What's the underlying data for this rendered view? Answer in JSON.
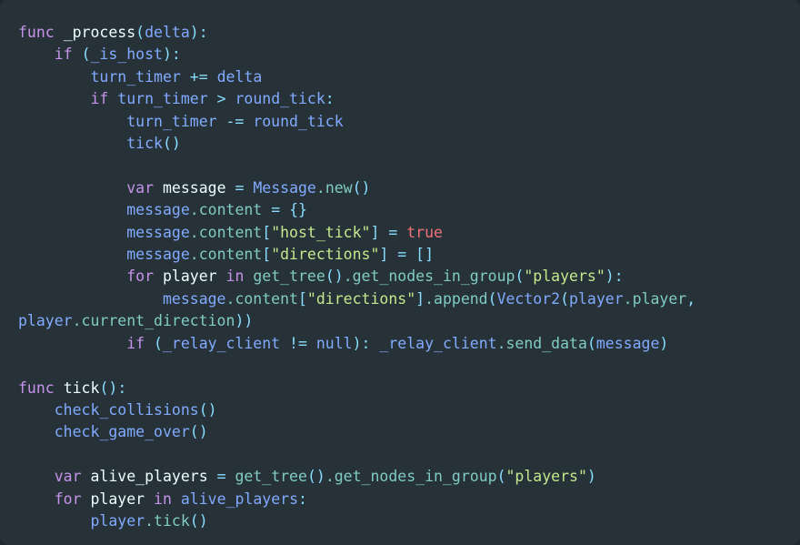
{
  "editor": {
    "background": "#263238",
    "outer_background": "#22292e",
    "language": "gdscript",
    "colors": {
      "keyword": "#c792ea",
      "identifier": "#82aaff",
      "member": "#80cbc4",
      "string": "#c3e88d",
      "constant": "#f07178",
      "punctuation": "#89ddff",
      "plain": "#eeffff",
      "default_text": "#b0bec5"
    }
  },
  "code": {
    "lines": [
      {
        "id": "line-1",
        "tokens": [
          {
            "t": "func",
            "c": "kw"
          },
          {
            "t": " ",
            "c": "plain"
          },
          {
            "t": "_process",
            "c": "plain"
          },
          {
            "t": "(",
            "c": "punc"
          },
          {
            "t": "delta",
            "c": "ident"
          },
          {
            "t": ")",
            "c": "punc"
          },
          {
            "t": ":",
            "c": "punc"
          }
        ]
      },
      {
        "id": "line-2",
        "tokens": [
          {
            "t": "    ",
            "c": "plain"
          },
          {
            "t": "if",
            "c": "kw"
          },
          {
            "t": " ",
            "c": "plain"
          },
          {
            "t": "(",
            "c": "punc"
          },
          {
            "t": "_is_host",
            "c": "ident"
          },
          {
            "t": ")",
            "c": "punc"
          },
          {
            "t": ":",
            "c": "punc"
          }
        ]
      },
      {
        "id": "line-3",
        "tokens": [
          {
            "t": "        ",
            "c": "plain"
          },
          {
            "t": "turn_timer",
            "c": "ident"
          },
          {
            "t": " ",
            "c": "plain"
          },
          {
            "t": "+=",
            "c": "op"
          },
          {
            "t": " ",
            "c": "plain"
          },
          {
            "t": "delta",
            "c": "ident"
          }
        ]
      },
      {
        "id": "line-4",
        "tokens": [
          {
            "t": "        ",
            "c": "plain"
          },
          {
            "t": "if",
            "c": "kw"
          },
          {
            "t": " ",
            "c": "plain"
          },
          {
            "t": "turn_timer",
            "c": "ident"
          },
          {
            "t": " ",
            "c": "plain"
          },
          {
            "t": ">",
            "c": "op"
          },
          {
            "t": " ",
            "c": "plain"
          },
          {
            "t": "round_tick",
            "c": "ident"
          },
          {
            "t": ":",
            "c": "punc"
          }
        ]
      },
      {
        "id": "line-5",
        "tokens": [
          {
            "t": "            ",
            "c": "plain"
          },
          {
            "t": "turn_timer",
            "c": "ident"
          },
          {
            "t": " ",
            "c": "plain"
          },
          {
            "t": "-=",
            "c": "op"
          },
          {
            "t": " ",
            "c": "plain"
          },
          {
            "t": "round_tick",
            "c": "ident"
          }
        ]
      },
      {
        "id": "line-6",
        "tokens": [
          {
            "t": "            ",
            "c": "plain"
          },
          {
            "t": "tick",
            "c": "ident"
          },
          {
            "t": "()",
            "c": "punc"
          }
        ]
      },
      {
        "id": "line-7",
        "tokens": []
      },
      {
        "id": "line-8",
        "tokens": [
          {
            "t": "            ",
            "c": "plain"
          },
          {
            "t": "var",
            "c": "kw"
          },
          {
            "t": " ",
            "c": "plain"
          },
          {
            "t": "message",
            "c": "plain"
          },
          {
            "t": " ",
            "c": "plain"
          },
          {
            "t": "=",
            "c": "op"
          },
          {
            "t": " ",
            "c": "plain"
          },
          {
            "t": "Message",
            "c": "ident"
          },
          {
            "t": ".",
            "c": "prop"
          },
          {
            "t": "new",
            "c": "prop"
          },
          {
            "t": "()",
            "c": "punc"
          }
        ]
      },
      {
        "id": "line-9",
        "tokens": [
          {
            "t": "            ",
            "c": "plain"
          },
          {
            "t": "message",
            "c": "ident"
          },
          {
            "t": ".",
            "c": "prop"
          },
          {
            "t": "content",
            "c": "prop"
          },
          {
            "t": " ",
            "c": "plain"
          },
          {
            "t": "=",
            "c": "op"
          },
          {
            "t": " ",
            "c": "plain"
          },
          {
            "t": "{}",
            "c": "punc"
          }
        ]
      },
      {
        "id": "line-10",
        "tokens": [
          {
            "t": "            ",
            "c": "plain"
          },
          {
            "t": "message",
            "c": "ident"
          },
          {
            "t": ".",
            "c": "prop"
          },
          {
            "t": "content",
            "c": "prop"
          },
          {
            "t": "[",
            "c": "punc"
          },
          {
            "t": "\"host_tick\"",
            "c": "str"
          },
          {
            "t": "]",
            "c": "punc"
          },
          {
            "t": " ",
            "c": "plain"
          },
          {
            "t": "=",
            "c": "op"
          },
          {
            "t": " ",
            "c": "plain"
          },
          {
            "t": "true",
            "c": "const"
          }
        ]
      },
      {
        "id": "line-11",
        "tokens": [
          {
            "t": "            ",
            "c": "plain"
          },
          {
            "t": "message",
            "c": "ident"
          },
          {
            "t": ".",
            "c": "prop"
          },
          {
            "t": "content",
            "c": "prop"
          },
          {
            "t": "[",
            "c": "punc"
          },
          {
            "t": "\"directions\"",
            "c": "str"
          },
          {
            "t": "]",
            "c": "punc"
          },
          {
            "t": " ",
            "c": "plain"
          },
          {
            "t": "=",
            "c": "op"
          },
          {
            "t": " ",
            "c": "plain"
          },
          {
            "t": "[]",
            "c": "punc"
          }
        ]
      },
      {
        "id": "line-12",
        "tokens": [
          {
            "t": "            ",
            "c": "plain"
          },
          {
            "t": "for",
            "c": "kw"
          },
          {
            "t": " ",
            "c": "plain"
          },
          {
            "t": "player",
            "c": "plain"
          },
          {
            "t": " ",
            "c": "plain"
          },
          {
            "t": "in",
            "c": "kw"
          },
          {
            "t": " ",
            "c": "plain"
          },
          {
            "t": "get_tree",
            "c": "prop"
          },
          {
            "t": "()",
            "c": "punc"
          },
          {
            "t": ".",
            "c": "prop"
          },
          {
            "t": "get_nodes_in_group",
            "c": "prop"
          },
          {
            "t": "(",
            "c": "punc"
          },
          {
            "t": "\"players\"",
            "c": "str"
          },
          {
            "t": ")",
            "c": "punc"
          },
          {
            "t": ":",
            "c": "punc"
          }
        ]
      },
      {
        "id": "line-13",
        "tokens": [
          {
            "t": "                ",
            "c": "plain"
          },
          {
            "t": "message",
            "c": "ident"
          },
          {
            "t": ".",
            "c": "prop"
          },
          {
            "t": "content",
            "c": "prop"
          },
          {
            "t": "[",
            "c": "punc"
          },
          {
            "t": "\"directions\"",
            "c": "str"
          },
          {
            "t": "]",
            "c": "punc"
          },
          {
            "t": ".",
            "c": "prop"
          },
          {
            "t": "append",
            "c": "prop"
          },
          {
            "t": "(",
            "c": "punc"
          },
          {
            "t": "Vector2",
            "c": "ident"
          },
          {
            "t": "(",
            "c": "punc"
          },
          {
            "t": "player",
            "c": "ident"
          },
          {
            "t": ".",
            "c": "prop"
          },
          {
            "t": "player",
            "c": "prop"
          },
          {
            "t": ", ",
            "c": "punc"
          },
          {
            "t": "player",
            "c": "ident"
          },
          {
            "t": ".",
            "c": "prop"
          },
          {
            "t": "current_direction",
            "c": "prop"
          },
          {
            "t": "))",
            "c": "punc"
          }
        ]
      },
      {
        "id": "line-14",
        "tokens": [
          {
            "t": "            ",
            "c": "plain"
          },
          {
            "t": "if",
            "c": "kw"
          },
          {
            "t": " ",
            "c": "plain"
          },
          {
            "t": "(",
            "c": "punc"
          },
          {
            "t": "_relay_client",
            "c": "ident"
          },
          {
            "t": " ",
            "c": "plain"
          },
          {
            "t": "!=",
            "c": "op"
          },
          {
            "t": " ",
            "c": "plain"
          },
          {
            "t": "null",
            "c": "ident"
          },
          {
            "t": ")",
            "c": "punc"
          },
          {
            "t": ":",
            "c": "punc"
          },
          {
            "t": " ",
            "c": "plain"
          },
          {
            "t": "_relay_client",
            "c": "ident"
          },
          {
            "t": ".",
            "c": "prop"
          },
          {
            "t": "send_data",
            "c": "prop"
          },
          {
            "t": "(",
            "c": "punc"
          },
          {
            "t": "message",
            "c": "ident"
          },
          {
            "t": ")",
            "c": "punc"
          }
        ]
      },
      {
        "id": "line-15",
        "tokens": []
      },
      {
        "id": "line-16",
        "tokens": [
          {
            "t": "func",
            "c": "kw"
          },
          {
            "t": " ",
            "c": "plain"
          },
          {
            "t": "tick",
            "c": "plain"
          },
          {
            "t": "()",
            "c": "punc"
          },
          {
            "t": ":",
            "c": "punc"
          }
        ]
      },
      {
        "id": "line-17",
        "tokens": [
          {
            "t": "    ",
            "c": "plain"
          },
          {
            "t": "check_collisions",
            "c": "ident"
          },
          {
            "t": "()",
            "c": "punc"
          }
        ]
      },
      {
        "id": "line-18",
        "tokens": [
          {
            "t": "    ",
            "c": "plain"
          },
          {
            "t": "check_game_over",
            "c": "ident"
          },
          {
            "t": "()",
            "c": "punc"
          }
        ]
      },
      {
        "id": "line-19",
        "tokens": []
      },
      {
        "id": "line-20",
        "tokens": [
          {
            "t": "    ",
            "c": "plain"
          },
          {
            "t": "var",
            "c": "kw"
          },
          {
            "t": " ",
            "c": "plain"
          },
          {
            "t": "alive_players",
            "c": "plain"
          },
          {
            "t": " ",
            "c": "plain"
          },
          {
            "t": "=",
            "c": "op"
          },
          {
            "t": " ",
            "c": "plain"
          },
          {
            "t": "get_tree",
            "c": "prop"
          },
          {
            "t": "()",
            "c": "punc"
          },
          {
            "t": ".",
            "c": "prop"
          },
          {
            "t": "get_nodes_in_group",
            "c": "prop"
          },
          {
            "t": "(",
            "c": "punc"
          },
          {
            "t": "\"players\"",
            "c": "str"
          },
          {
            "t": ")",
            "c": "punc"
          }
        ]
      },
      {
        "id": "line-21",
        "tokens": [
          {
            "t": "    ",
            "c": "plain"
          },
          {
            "t": "for",
            "c": "kw"
          },
          {
            "t": " ",
            "c": "plain"
          },
          {
            "t": "player",
            "c": "plain"
          },
          {
            "t": " ",
            "c": "plain"
          },
          {
            "t": "in",
            "c": "kw"
          },
          {
            "t": " ",
            "c": "plain"
          },
          {
            "t": "alive_players",
            "c": "ident"
          },
          {
            "t": ":",
            "c": "punc"
          }
        ]
      },
      {
        "id": "line-22",
        "tokens": [
          {
            "t": "        ",
            "c": "plain"
          },
          {
            "t": "player",
            "c": "ident"
          },
          {
            "t": ".",
            "c": "prop"
          },
          {
            "t": "tick",
            "c": "prop"
          },
          {
            "t": "()",
            "c": "punc"
          }
        ]
      }
    ]
  }
}
